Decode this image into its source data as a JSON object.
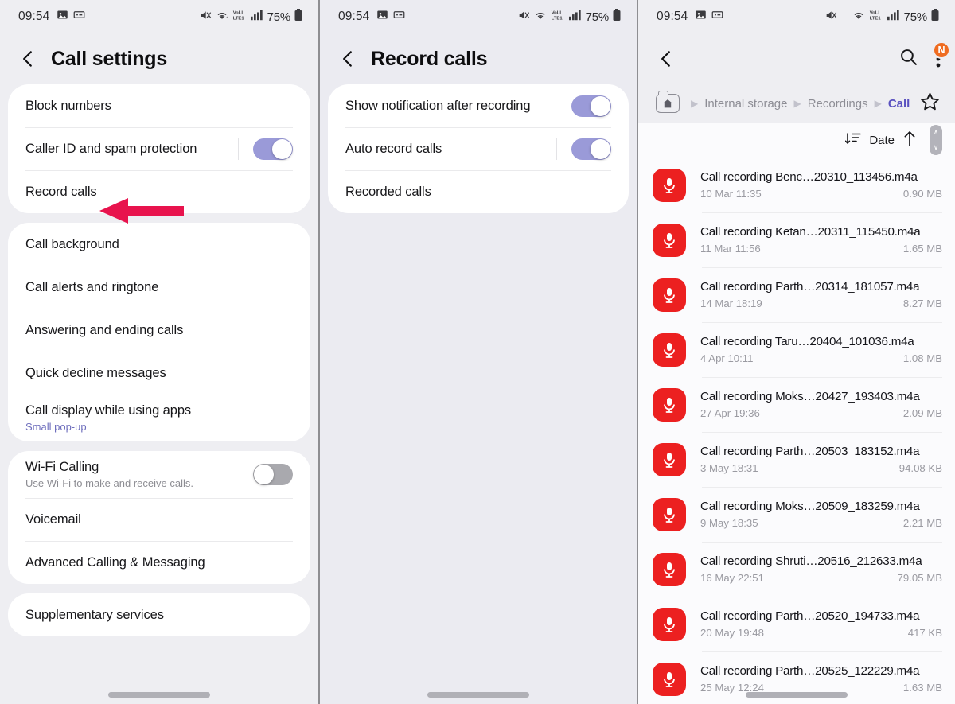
{
  "status_bar": {
    "time": "09:54",
    "battery": "75%",
    "left_icons": [
      "image-icon",
      "otg-icon"
    ],
    "right_icons": [
      "mute-icon",
      "wifi-icon",
      "volte-icon",
      "signal-icon",
      "battery-icon"
    ]
  },
  "panel_left": {
    "title": "Call settings",
    "back_icon": "back-chevron-icon",
    "groups": [
      {
        "rows": [
          {
            "title": "Block numbers"
          },
          {
            "title": "Caller ID and spam protection",
            "toggle": "on",
            "divider": true
          },
          {
            "title": "Record calls",
            "annotated": true
          }
        ]
      },
      {
        "rows": [
          {
            "title": "Call background"
          },
          {
            "title": "Call alerts and ringtone"
          },
          {
            "title": "Answering and ending calls"
          },
          {
            "title": "Quick decline messages"
          },
          {
            "title": "Call display while using apps",
            "subtitle": "Small pop-up"
          }
        ]
      },
      {
        "rows": [
          {
            "title": "Wi-Fi Calling",
            "subtitle": "Use Wi-Fi to make and receive calls.",
            "toggle": "off"
          },
          {
            "title": "Voicemail"
          },
          {
            "title": "Advanced Calling & Messaging"
          }
        ]
      },
      {
        "rows": [
          {
            "title": "Supplementary services"
          }
        ]
      }
    ]
  },
  "panel_middle": {
    "title": "Record calls",
    "back_icon": "back-chevron-icon",
    "rows": [
      {
        "title": "Show notification after recording",
        "toggle": "on"
      },
      {
        "title": "Auto record calls",
        "toggle": "on",
        "divider": true
      },
      {
        "title": "Recorded calls",
        "annotated": true
      }
    ]
  },
  "panel_right": {
    "back_icon": "back-chevron-icon",
    "search_icon": "search-icon",
    "menu_icon": "more-options-icon",
    "menu_badge": "N",
    "breadcrumb": {
      "home_icon": "home-folder-icon",
      "items": [
        "Internal storage",
        "Recordings",
        "Call"
      ],
      "current": "Call",
      "separator": "▶",
      "favorite_icon": "star-icon"
    },
    "sort": {
      "icon": "sort-descending-icon",
      "label": "Date",
      "direction_icon": "arrow-up-icon",
      "scrollbar_up": "∧",
      "scrollbar_down": "∨"
    },
    "files": [
      {
        "name": "Call recording Benc…20310_113456.m4a",
        "date": "10 Mar 11:35",
        "size": "0.90 MB",
        "icon": "microphone-icon"
      },
      {
        "name": "Call recording Ketan…20311_115450.m4a",
        "date": "11 Mar 11:56",
        "size": "1.65 MB",
        "icon": "microphone-icon"
      },
      {
        "name": "Call recording Parth…20314_181057.m4a",
        "date": "14 Mar 18:19",
        "size": "8.27 MB",
        "icon": "microphone-icon"
      },
      {
        "name": "Call recording Taru…20404_101036.m4a",
        "date": "4 Apr 10:11",
        "size": "1.08 MB",
        "icon": "microphone-icon"
      },
      {
        "name": "Call recording Moks…20427_193403.m4a",
        "date": "27 Apr 19:36",
        "size": "2.09 MB",
        "icon": "microphone-icon"
      },
      {
        "name": "Call recording Parth…20503_183152.m4a",
        "date": "3 May 18:31",
        "size": "94.08 KB",
        "icon": "microphone-icon"
      },
      {
        "name": "Call recording Moks…20509_183259.m4a",
        "date": "9 May 18:35",
        "size": "2.21 MB",
        "icon": "microphone-icon"
      },
      {
        "name": "Call recording Shruti…20516_212633.m4a",
        "date": "16 May 22:51",
        "size": "79.05 MB",
        "icon": "microphone-icon"
      },
      {
        "name": "Call recording Parth…20520_194733.m4a",
        "date": "20 May 19:48",
        "size": "417 KB",
        "icon": "microphone-icon"
      },
      {
        "name": "Call recording Parth…20525_122229.m4a",
        "date": "25 May 12:24",
        "size": "1.63 MB",
        "icon": "microphone-icon"
      }
    ]
  },
  "colors": {
    "annotation_arrow": "#e8134d",
    "toggle_on": "#9a9ad8",
    "toggle_off": "#a9a9ae",
    "mic_icon_bg": "#ec2020",
    "badge_orange": "#ef6c21",
    "breadcrumb_current": "#5a51c0",
    "accent_subtitle": "#6f6fbd"
  }
}
